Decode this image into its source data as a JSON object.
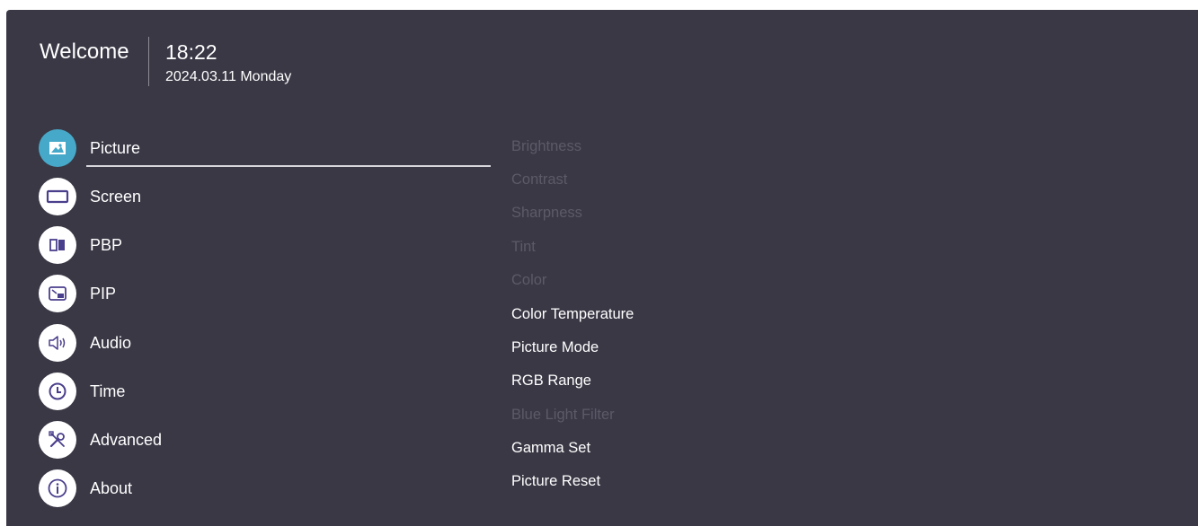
{
  "header": {
    "welcome": "Welcome",
    "time": "18:22",
    "date": "2024.03.11 Monday"
  },
  "menu": [
    {
      "label": "Picture",
      "icon": "picture-icon",
      "active": true
    },
    {
      "label": "Screen",
      "icon": "screen-icon",
      "active": false
    },
    {
      "label": "PBP",
      "icon": "pbp-icon",
      "active": false
    },
    {
      "label": "PIP",
      "icon": "pip-icon",
      "active": false
    },
    {
      "label": "Audio",
      "icon": "speaker-icon",
      "active": false
    },
    {
      "label": "Time",
      "icon": "clock-icon",
      "active": false
    },
    {
      "label": "Advanced",
      "icon": "tools-icon",
      "active": false
    },
    {
      "label": "About",
      "icon": "info-icon",
      "active": false
    }
  ],
  "submenu": [
    {
      "label": "Brightness",
      "enabled": false
    },
    {
      "label": "Contrast",
      "enabled": false
    },
    {
      "label": "Sharpness",
      "enabled": false
    },
    {
      "label": "Tint",
      "enabled": false
    },
    {
      "label": "Color",
      "enabled": false
    },
    {
      "label": "Color Temperature",
      "enabled": true
    },
    {
      "label": "Picture Mode",
      "enabled": true
    },
    {
      "label": "RGB Range",
      "enabled": true
    },
    {
      "label": "Blue Light Filter",
      "enabled": false
    },
    {
      "label": "Gamma Set",
      "enabled": true
    },
    {
      "label": "Picture Reset",
      "enabled": true
    }
  ],
  "colors": {
    "background": "#3a3845",
    "accent": "#47a9c9",
    "icon_glyph": "#4a3f8c",
    "disabled_text": "#5c5a67"
  }
}
